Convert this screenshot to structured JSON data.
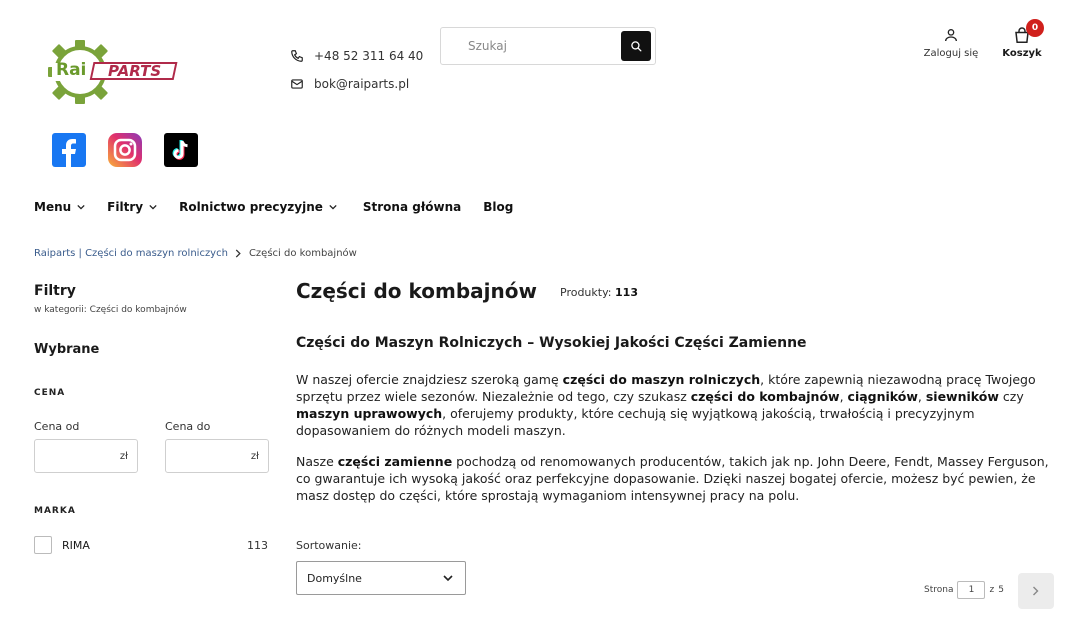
{
  "header": {
    "logo_text_a": "Rai",
    "logo_text_b": "PARTS",
    "phone": "+48 52 311 64 40",
    "email": "bok@raiparts.pl",
    "search": {
      "placeholder": "Szukaj"
    },
    "account_label": "Zaloguj się",
    "cart_label": "Koszyk",
    "cart_count": "0"
  },
  "social": [
    "facebook-icon",
    "instagram-icon",
    "tiktok-icon"
  ],
  "nav": {
    "menu": "Menu",
    "filtry": "Filtry",
    "rolnictwo": "Rolnictwo precyzyjne",
    "home": "Strona główna",
    "blog": "Blog"
  },
  "breadcrumb": {
    "home": "Raiparts | Części do maszyn rolniczych",
    "current": "Części do kombajnów"
  },
  "sidebar": {
    "title": "Filtry",
    "subtitle": "w kategorii: Części do kombajnów",
    "selected": "Wybrane",
    "price_heading": "CENA",
    "price_from": "Cena od",
    "price_to": "Cena do",
    "currency": "zł",
    "brand_heading": "MARKA",
    "brand_name": "RIMA",
    "brand_count": "113"
  },
  "main": {
    "title": "Części do kombajnów",
    "products_label": "Produkty:",
    "products_count": "113",
    "heading": "Części do Maszyn Rolniczych – Wysokiej Jakości Części Zamienne",
    "p1": {
      "a": "W naszej ofercie znajdziesz szeroką gamę ",
      "b": "części do maszyn rolniczych",
      "c": ", które zapewnią niezawodną pracę Twojego sprzętu przez wiele sezonów. Niezależnie od tego, czy szukasz ",
      "d": "części do kombajnów",
      "e": ", ",
      "f": "ciągników",
      "g": ", ",
      "h": "siewników",
      "i": " czy ",
      "j": "maszyn uprawowych",
      "k": ", oferujemy produkty, które cechują się wyjątkową jakością, trwałością i precyzyjnym dopasowaniem do różnych modeli maszyn."
    },
    "p2": {
      "a": "Nasze ",
      "b": "części zamienne",
      "c": " pochodzą od renomowanych producentów, takich jak np. John Deere, Fendt, Massey Ferguson, co gwarantuje ich wysoką jakość oraz perfekcyjne dopasowanie. Dzięki naszej bogatej ofercie, możesz być pewien, że masz dostęp do części, które sprostają wymaganiom intensywnej pracy na polu."
    },
    "sort_label": "Sortowanie:",
    "sort_value": "Domyślne",
    "pager": {
      "prefix": "Strona",
      "current": "1",
      "sep": "z",
      "total": "5"
    }
  }
}
